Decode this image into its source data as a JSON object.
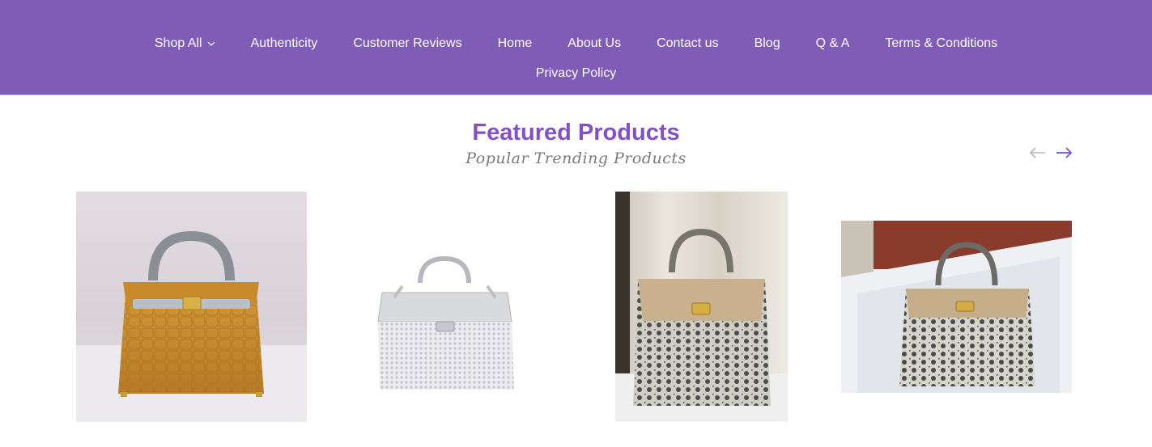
{
  "nav": {
    "items": [
      {
        "label": "Shop All",
        "has_dropdown": true
      },
      {
        "label": "Authenticity"
      },
      {
        "label": "Customer Reviews"
      },
      {
        "label": "Home"
      },
      {
        "label": "About Us"
      },
      {
        "label": "Contact us"
      },
      {
        "label": "Blog"
      },
      {
        "label": "Q & A"
      },
      {
        "label": "Terms & Conditions"
      },
      {
        "label": "Privacy Policy"
      }
    ],
    "background": "#7f5cb6"
  },
  "featured": {
    "title": "Featured Products",
    "subtitle": "Popular Trending Products",
    "title_color": "#8250c8",
    "prev_icon": "arrow-left-icon",
    "next_icon": "arrow-right-icon"
  },
  "products": [
    {
      "image": "tan crocodile handbag"
    },
    {
      "image": "silver crystal handbag"
    },
    {
      "image": "lizard skin handbag"
    },
    {
      "image": "lizard skin handbag in box"
    }
  ]
}
